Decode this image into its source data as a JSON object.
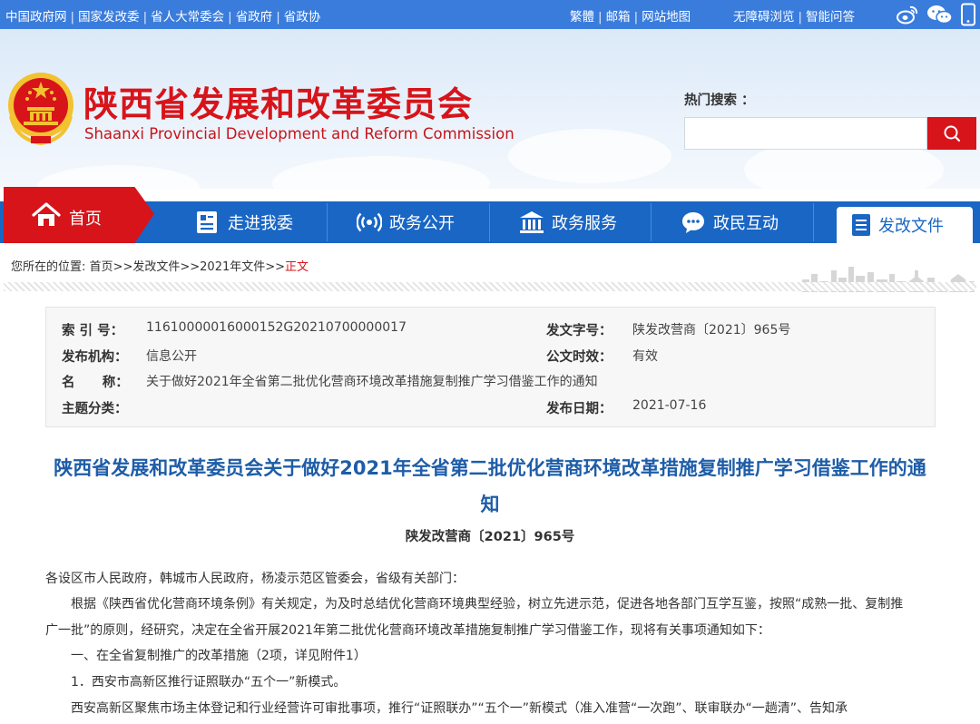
{
  "topbar": {
    "links_left": [
      "中国政府网",
      "国家发改委",
      "省人大常委会",
      "省政府",
      "省政协"
    ],
    "links_mid": [
      "繁體",
      "邮箱",
      "网站地图"
    ],
    "links_right": [
      "无障碍浏览",
      "智能问答"
    ],
    "icons": [
      "weibo-icon",
      "wechat-icon",
      "mobile-icon"
    ]
  },
  "header": {
    "title": "陕西省发展和改革委员会",
    "subtitle": "Shaanxi Provincial Development and Reform Commission",
    "hot_search_label": "热门搜索 ：",
    "search_placeholder": ""
  },
  "nav": {
    "home": "首页",
    "items": [
      "走进我委",
      "政务公开",
      "政务服务",
      "政民互动"
    ],
    "active": "发改文件"
  },
  "breadcrumb": {
    "prefix": "您所在的位置:",
    "items": [
      "首页",
      "发改文件",
      "2021年文件"
    ],
    "separator": ">>",
    "current": "正文"
  },
  "info": {
    "index_label": "索  引  号：",
    "index_value": "11610000016000152G20210700000017",
    "docno_label": "发文字号：",
    "docno_value": "陕发改营商〔2021〕965号",
    "org_label": "发布机构：",
    "org_value": "信息公开",
    "validity_label": "公文时效：",
    "validity_value": "有效",
    "name_label": "名      称：",
    "name_value": "关于做好2021年全省第二批优化营商环境改革措施复制推广学习借鉴工作的通知",
    "category_label": "主题分类：",
    "category_value": "",
    "date_label": "发布日期：",
    "date_value": "2021-07-16"
  },
  "article": {
    "title_line1": "陕西省发展和改革委员会关于做好2021年全省第二批优化营商环境改革措施复制推广学习借鉴工作的通",
    "title_line2": "知",
    "docno": "陕发改营商〔2021〕965号",
    "p1": "各设区市人民政府，韩城市人民政府，杨凌示范区管委会，省级有关部门：",
    "p2a": "根据《陕西省优化营商环境条例》有关规定，为及时总结优化营商环境典型经验，树立先进示范，促进各地各部门互学互鉴，按照“成熟一批、复制推",
    "p2b": "广一批”的原则，经研究，决定在全省开展2021年第二批优化营商环境改革措施复制推广学习借鉴工作，现将有关事项通知如下：",
    "p3": "一、在全省复制推广的改革措施（2项，详见附件1）",
    "p4": "1．西安市高新区推行证照联办“五个一”新模式。",
    "p5": "西安高新区聚焦市场主体登记和行业经营许可审批事项，推行“证照联办”“五个一”新模式（准入准营“一次跑”、联审联办“一趟清”、告知承"
  },
  "colors": {
    "topbar": "#3a7cdc",
    "nav": "#1966c4",
    "brand_red": "#d7141a",
    "title_blue": "#1e5da8"
  }
}
